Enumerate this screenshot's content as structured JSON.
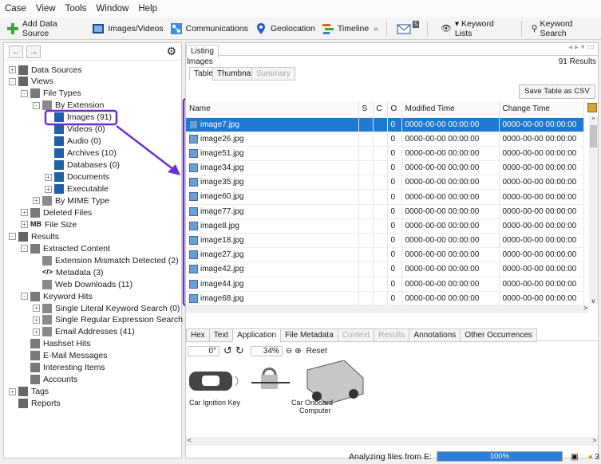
{
  "menu": [
    "Case",
    "View",
    "Tools",
    "Window",
    "Help"
  ],
  "toolbar": {
    "add_data_source": "Add Data Source",
    "images_videos": "Images/Videos",
    "communications": "Communications",
    "geolocation": "Geolocation",
    "timeline": "Timeline",
    "mail_badge": "5",
    "keyword_lists": "▾ Keyword Lists",
    "keyword_search": "Keyword Search"
  },
  "tree": [
    {
      "label": "Data Sources",
      "depth": 0,
      "exp": "+"
    },
    {
      "label": "Views",
      "depth": 0,
      "exp": "-"
    },
    {
      "label": "File Types",
      "depth": 1,
      "exp": "-"
    },
    {
      "label": "By Extension",
      "depth": 2,
      "exp": "-"
    },
    {
      "label": "Images (91)",
      "depth": 3,
      "exp": ""
    },
    {
      "label": "Videos (0)",
      "depth": 3,
      "exp": ""
    },
    {
      "label": "Audio (0)",
      "depth": 3,
      "exp": ""
    },
    {
      "label": "Archives (10)",
      "depth": 3,
      "exp": ""
    },
    {
      "label": "Databases (0)",
      "depth": 3,
      "exp": ""
    },
    {
      "label": "Documents",
      "depth": 3,
      "exp": "+"
    },
    {
      "label": "Executable",
      "depth": 3,
      "exp": "+"
    },
    {
      "label": "By MIME Type",
      "depth": 2,
      "exp": "+"
    },
    {
      "label": "Deleted Files",
      "depth": 1,
      "exp": "+"
    },
    {
      "label": "File Size",
      "depth": 1,
      "exp": "+",
      "prefix": "MB"
    },
    {
      "label": "Results",
      "depth": 0,
      "exp": "-"
    },
    {
      "label": "Extracted Content",
      "depth": 1,
      "exp": "-"
    },
    {
      "label": "Extension Mismatch Detected (2)",
      "depth": 2,
      "exp": ""
    },
    {
      "label": "Metadata (3)",
      "depth": 2,
      "exp": "",
      "prefix": "</>"
    },
    {
      "label": "Web Downloads (11)",
      "depth": 2,
      "exp": ""
    },
    {
      "label": "Keyword Hits",
      "depth": 1,
      "exp": "-"
    },
    {
      "label": "Single Literal Keyword Search (0)",
      "depth": 2,
      "exp": "+"
    },
    {
      "label": "Single Regular Expression Search (0)",
      "depth": 2,
      "exp": "+"
    },
    {
      "label": "Email Addresses (41)",
      "depth": 2,
      "exp": "+"
    },
    {
      "label": "Hashset Hits",
      "depth": 1,
      "exp": ""
    },
    {
      "label": "E-Mail Messages",
      "depth": 1,
      "exp": ""
    },
    {
      "label": "Interesting Items",
      "depth": 1,
      "exp": ""
    },
    {
      "label": "Accounts",
      "depth": 1,
      "exp": ""
    },
    {
      "label": "Tags",
      "depth": 0,
      "exp": "+"
    },
    {
      "label": "Reports",
      "depth": 0,
      "exp": ""
    }
  ],
  "listing": {
    "tab": "Listing",
    "title": "Images",
    "results": "91  Results",
    "subtabs": [
      "Table",
      "Thumbnail",
      "Summary"
    ],
    "save_csv": "Save Table as CSV",
    "columns": [
      "Name",
      "S",
      "C",
      "O",
      "Modified Time",
      "Change Time"
    ],
    "rows": [
      [
        "image7.jpg",
        "",
        "",
        "0",
        "0000-00-00 00:00:00",
        "0000-00-00 00:00:00"
      ],
      [
        "image26.jpg",
        "",
        "",
        "0",
        "0000-00-00 00:00:00",
        "0000-00-00 00:00:00"
      ],
      [
        "image51.jpg",
        "",
        "",
        "0",
        "0000-00-00 00:00:00",
        "0000-00-00 00:00:00"
      ],
      [
        "image34.jpg",
        "",
        "",
        "0",
        "0000-00-00 00:00:00",
        "0000-00-00 00:00:00"
      ],
      [
        "image35.jpg",
        "",
        "",
        "0",
        "0000-00-00 00:00:00",
        "0000-00-00 00:00:00"
      ],
      [
        "image60.jpg",
        "",
        "",
        "0",
        "0000-00-00 00:00:00",
        "0000-00-00 00:00:00"
      ],
      [
        "image77.jpg",
        "",
        "",
        "0",
        "0000-00-00 00:00:00",
        "0000-00-00 00:00:00"
      ],
      [
        "image8.jpg",
        "",
        "",
        "0",
        "0000-00-00 00:00:00",
        "0000-00-00 00:00:00"
      ],
      [
        "image18.jpg",
        "",
        "",
        "0",
        "0000-00-00 00:00:00",
        "0000-00-00 00:00:00"
      ],
      [
        "image27.jpg",
        "",
        "",
        "0",
        "0000-00-00 00:00:00",
        "0000-00-00 00:00:00"
      ],
      [
        "image42.jpg",
        "",
        "",
        "0",
        "0000-00-00 00:00:00",
        "0000-00-00 00:00:00"
      ],
      [
        "image44.jpg",
        "",
        "",
        "0",
        "0000-00-00 00:00:00",
        "0000-00-00 00:00:00"
      ],
      [
        "image68.jpg",
        "",
        "",
        "0",
        "0000-00-00 00:00:00",
        "0000-00-00 00:00:00"
      ]
    ]
  },
  "content_tabs": [
    "Hex",
    "Text",
    "Application",
    "File Metadata",
    "Context",
    "Results",
    "Annotations",
    "Other Occurrences"
  ],
  "viewer": {
    "rotation": "0°",
    "zoom": "34%",
    "reset": "Reset",
    "label_left": "Car Ignition Key",
    "label_right_1": "Car Onboard",
    "label_right_2": "Computer"
  },
  "status": {
    "analyzing": "Analyzing files from E:",
    "progress": "100%",
    "progress_fraction": 1.0,
    "notifications": "3"
  },
  "colors": {
    "selection": "#1f78d1",
    "highlight_annotation": "#6a2fd1",
    "progress": "#2b7fd6"
  }
}
